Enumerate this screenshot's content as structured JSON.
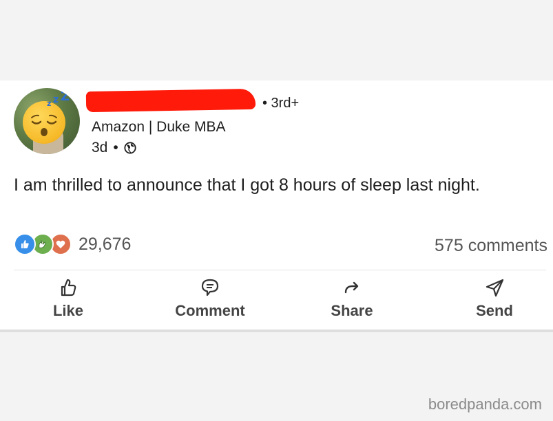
{
  "post": {
    "author_degree": "• 3rd+",
    "author_subtitle": "Amazon | Duke MBA",
    "time_ago": "3d",
    "time_separator": "•",
    "body": "I am thrilled to announce that I got 8 hours of sleep last night.",
    "reaction_count": "29,676",
    "comments_count": "575 comments",
    "reactions": [
      "like-reaction-icon",
      "celebrate-reaction-icon",
      "love-reaction-icon"
    ],
    "actions": [
      {
        "label": "Like",
        "icon": "thumbs-up-icon"
      },
      {
        "label": "Comment",
        "icon": "comment-icon"
      },
      {
        "label": "Share",
        "icon": "share-arrow-icon"
      },
      {
        "label": "Send",
        "icon": "send-icon"
      }
    ]
  },
  "watermark": "boredpanda.com",
  "colors": {
    "redaction": "#ff1a0a",
    "like_blue": "#378fe9",
    "celebrate_green": "#6dae4f",
    "love_orange": "#df704d"
  }
}
